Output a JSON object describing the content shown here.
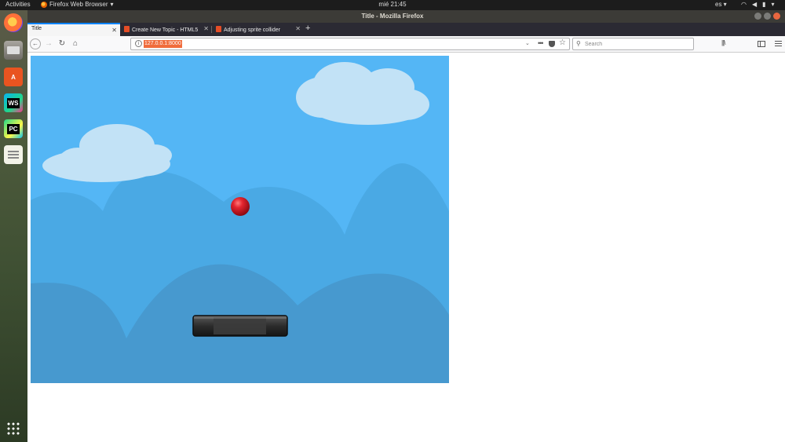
{
  "topbar": {
    "activities": "Activities",
    "app_name": "Firefox Web Browser",
    "clock": "mié 21:45",
    "language": "es"
  },
  "window": {
    "title": "Title - Mozilla Firefox"
  },
  "tabs": [
    {
      "label": "Title",
      "active": true
    },
    {
      "label": "Create New Topic - HTML5",
      "active": false
    },
    {
      "label": "Adjusting sprite collider",
      "active": false
    }
  ],
  "nav": {
    "url": "127.0.0.1:8000",
    "search_placeholder": "Search"
  },
  "game": {
    "sky_color": "#54b6f5",
    "hill_back_color": "#4aa9e4",
    "hill_front_color": "#4799cf",
    "cloud_color": "#c2e2f6",
    "ball_color": "#c8111c",
    "paddle_color": "#2a2a2a"
  },
  "dock": {
    "items": [
      "firefox-icon",
      "files-icon",
      "software-icon",
      "webstorm-icon",
      "pycharm-icon",
      "text-editor-icon",
      "show-apps-icon"
    ]
  }
}
